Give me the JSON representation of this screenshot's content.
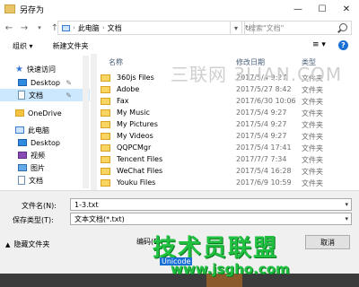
{
  "window": {
    "title": "另存为",
    "minimize": "—",
    "maximize": "☐",
    "close": "✕"
  },
  "address": {
    "parts": [
      "此电脑",
      "文档"
    ],
    "refresh_glyph": "↻",
    "dropdown_glyph": "▾"
  },
  "search": {
    "placeholder": "搜索\"文档\""
  },
  "toolbar": {
    "organize": "组织 ▾",
    "new_folder": "新建文件夹",
    "view_glyph": "≡ ▾",
    "help": "?"
  },
  "nav": {
    "items": [
      {
        "label": "快速访问",
        "icon": "star"
      },
      {
        "label": "Desktop",
        "icon": "desktop",
        "pinned": true
      },
      {
        "label": "文档",
        "icon": "doc",
        "pinned": true,
        "selected": true
      },
      {
        "label": "OneDrive",
        "icon": "folder"
      },
      {
        "label": "此电脑",
        "icon": "pc"
      },
      {
        "label": "Desktop",
        "icon": "desktop"
      },
      {
        "label": "视频",
        "icon": "video"
      },
      {
        "label": "图片",
        "icon": "pic"
      },
      {
        "label": "文档",
        "icon": "doc"
      }
    ]
  },
  "columns": {
    "name": "名称",
    "date": "修改日期",
    "type": "类型"
  },
  "files": [
    {
      "name": "360js Files",
      "date": "2017/5/4 9:27",
      "type": "文件夹"
    },
    {
      "name": "Adobe",
      "date": "2017/5/27 8:42",
      "type": "文件夹"
    },
    {
      "name": "Fax",
      "date": "2017/6/30 10:06",
      "type": "文件夹"
    },
    {
      "name": "My Music",
      "date": "2017/5/4 9:27",
      "type": "文件夹"
    },
    {
      "name": "My Pictures",
      "date": "2017/5/4 9:27",
      "type": "文件夹"
    },
    {
      "name": "My Videos",
      "date": "2017/5/4 9:27",
      "type": "文件夹"
    },
    {
      "name": "QQPCMgr",
      "date": "2017/5/4 17:41",
      "type": "文件夹"
    },
    {
      "name": "Tencent Files",
      "date": "2017/7/7 7:34",
      "type": "文件夹"
    },
    {
      "name": "WeChat Files",
      "date": "2017/5/4 16:28",
      "type": "文件夹"
    },
    {
      "name": "Youku Files",
      "date": "2017/6/9 10:59",
      "type": "文件夹"
    }
  ],
  "watermark_top": "三联网 3LIAN.COM",
  "save": {
    "filename_label": "文件名(N):",
    "filename_value": "1-3.txt",
    "type_label": "保存类型(T):",
    "type_value": "文本文档(*.txt)",
    "hide_folders": "隐藏文件夹",
    "encoding_label": "编码(E):",
    "cancel": "取消",
    "unicode_tip": "Unicode"
  },
  "watermark_green": "技术员联盟",
  "watermark_url": "www.jsgho.com"
}
